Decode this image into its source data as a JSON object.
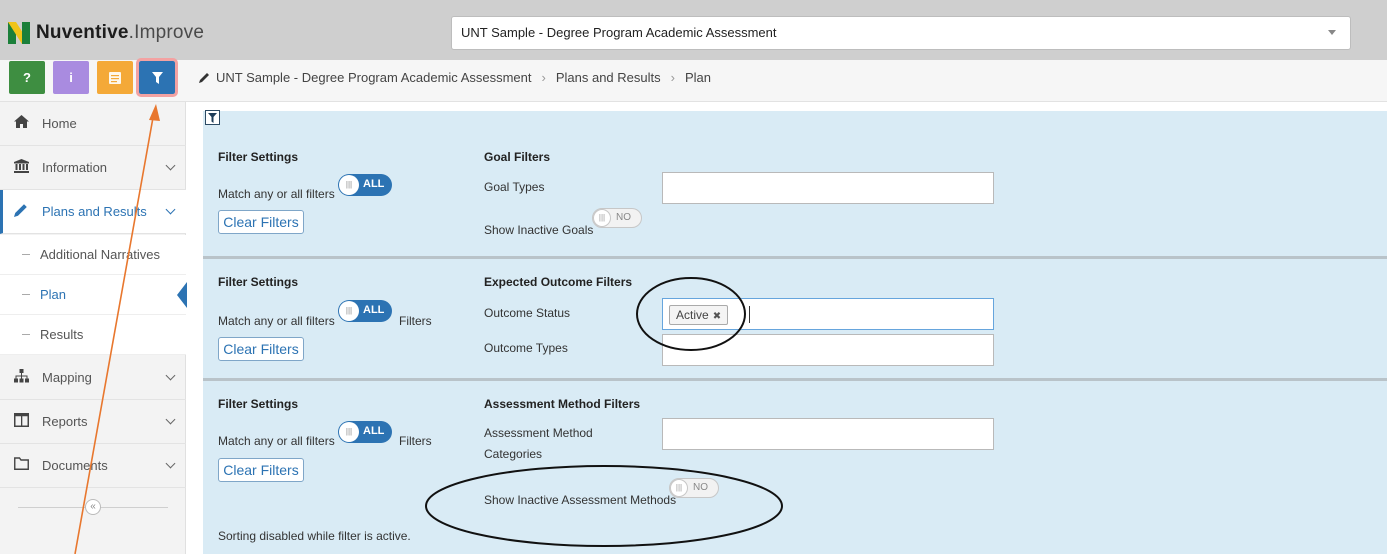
{
  "app": {
    "logo_brand": "Nuventive",
    "logo_product": ".Improve"
  },
  "program_select": {
    "value": "UNT Sample - Degree Program Academic Assessment"
  },
  "toolbar": {
    "help": "?",
    "info": "i",
    "notes": "≡",
    "filter": "▼"
  },
  "breadcrumb": {
    "items": [
      "UNT Sample - Degree Program Academic Assessment",
      "Plans and Results",
      "Plan"
    ]
  },
  "sidebar": {
    "items": [
      {
        "label": "Home",
        "icon": "home-icon"
      },
      {
        "label": "Information",
        "icon": "institution-icon"
      },
      {
        "label": "Plans and Results",
        "icon": "pencil-icon"
      },
      {
        "label": "Mapping",
        "icon": "sitemap-icon"
      },
      {
        "label": "Reports",
        "icon": "columns-icon"
      },
      {
        "label": "Documents",
        "icon": "folder-icon"
      }
    ],
    "subitems": [
      "Additional Narratives",
      "Plan",
      "Results"
    ]
  },
  "filters": {
    "settings_heading": "Filter Settings",
    "match_label": "Match any or all filters",
    "all_toggle": "ALL",
    "no_toggle": "NO",
    "filters_word": "Filters",
    "clear_label": "Clear Filters",
    "goal": {
      "heading": "Goal Filters",
      "types_label": "Goal Types",
      "inactive_label": "Show Inactive Goals"
    },
    "outcome": {
      "heading": "Expected Outcome Filters",
      "status_label": "Outcome Status",
      "status_tag": "Active",
      "types_label": "Outcome Types"
    },
    "method": {
      "heading": "Assessment Method Filters",
      "categories_label_1": "Assessment Method",
      "categories_label_2": "Categories",
      "inactive_label": "Show Inactive Assessment Methods"
    },
    "sorting_note": "Sorting disabled while filter is active."
  },
  "colors": {
    "accent": "#2c73b3",
    "panel_bg": "#d9ebf5",
    "annotation": "#e8772e"
  }
}
